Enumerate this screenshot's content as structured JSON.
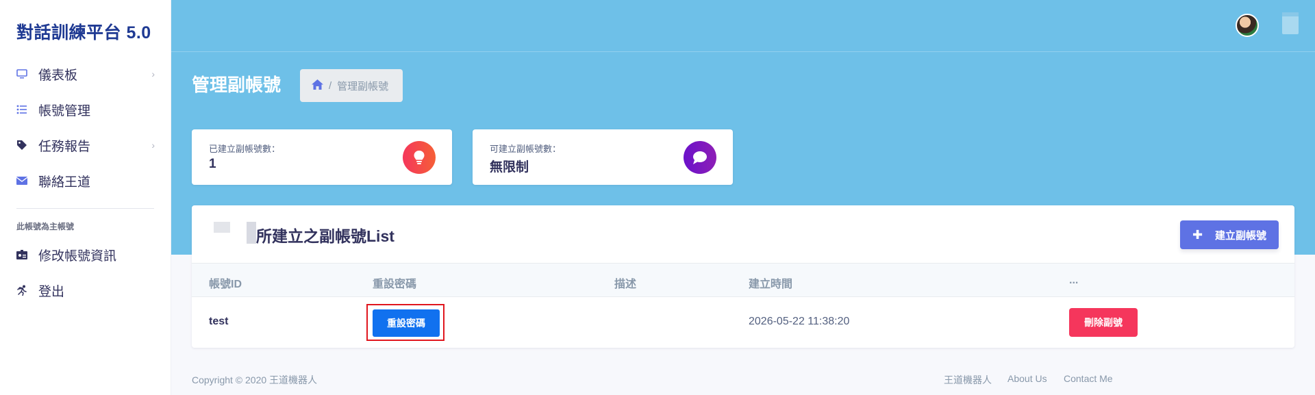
{
  "sidebar": {
    "brand": "對話訓練平台 5.0",
    "items": [
      {
        "label": "儀表板",
        "icon": "monitor-icon",
        "has_children": true
      },
      {
        "label": "帳號管理",
        "icon": "list-icon",
        "has_children": false
      },
      {
        "label": "任務報告",
        "icon": "tag-icon",
        "has_children": true
      },
      {
        "label": "聯絡王道",
        "icon": "envelope-icon",
        "has_children": false
      }
    ],
    "section_title": "此帳號為主帳號",
    "account_items": [
      {
        "label": "修改帳號資訊",
        "icon": "id-card-icon"
      },
      {
        "label": "登出",
        "icon": "running-icon"
      }
    ]
  },
  "header": {
    "page_title": "管理副帳號",
    "breadcrumb": {
      "home_icon": "home-icon",
      "current": "管理副帳號"
    }
  },
  "stats": [
    {
      "label": "已建立副帳號數：",
      "value": "1",
      "icon": "lightbulb-icon",
      "color": "#f5365c"
    },
    {
      "label": "可建立副帳號數：",
      "value": "無限制",
      "icon": "chat-bubble-icon",
      "color": "#6a11cb"
    }
  ],
  "table": {
    "title": "所建立之副帳號List",
    "create_button": "建立副帳號",
    "columns": [
      "帳號ID",
      "重設密碼",
      "描述",
      "建立時間",
      "..."
    ],
    "rows": [
      {
        "id": "test",
        "reset_label": "重設密碼",
        "description": "",
        "created": "2026-05-22 11:38:20",
        "delete_label": "刪除副號"
      }
    ]
  },
  "footer": {
    "copyright": "Copyright © 2020 王道機器人",
    "links": [
      "王道機器人",
      "About Us",
      "Contact Me"
    ]
  },
  "colors": {
    "header_bg": "#6ec0e8",
    "primary": "#5e72e4",
    "reset_blue": "#1171ef",
    "danger": "#f5365c",
    "brand_text": "#1f3a93"
  }
}
